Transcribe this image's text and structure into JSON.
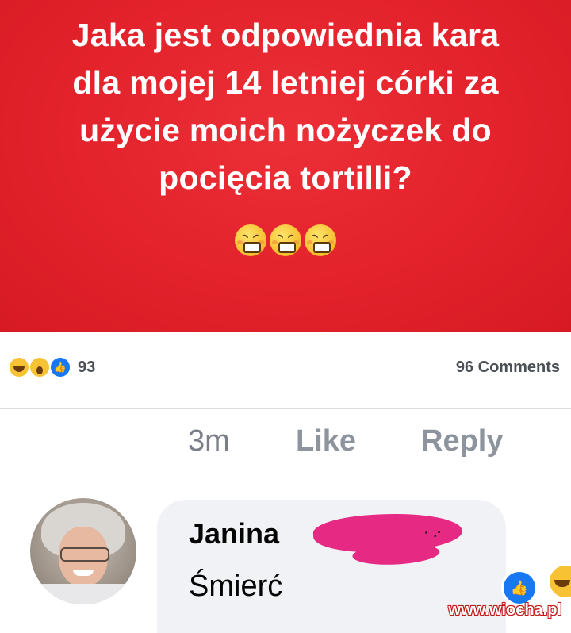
{
  "post": {
    "text": "Jaka jest odpowiednia kara\ndla mojej 14 letniej córki za\nużycie moich nożyczek do\npocięcia tortilli?",
    "background_color": "#e3222b",
    "emojis": [
      "grimacing-face-icon",
      "grimacing-face-icon",
      "grimacing-face-icon"
    ]
  },
  "stats": {
    "reaction_icons": [
      "haha-icon",
      "wow-icon",
      "like-icon"
    ],
    "reaction_count": "93",
    "comments": "96 Comments"
  },
  "comment_actions": {
    "time": "3m",
    "like": "Like",
    "reply": "Reply"
  },
  "comment": {
    "author": "Janina",
    "text": "Śmierć",
    "reactions": [
      "like-icon",
      "haha-icon"
    ]
  },
  "watermark": "www.wiocha.pl",
  "colors": {
    "facebook_blue": "#1877f2",
    "bubble_gray": "#f0f2f5",
    "redaction_pink": "#e62a84"
  }
}
